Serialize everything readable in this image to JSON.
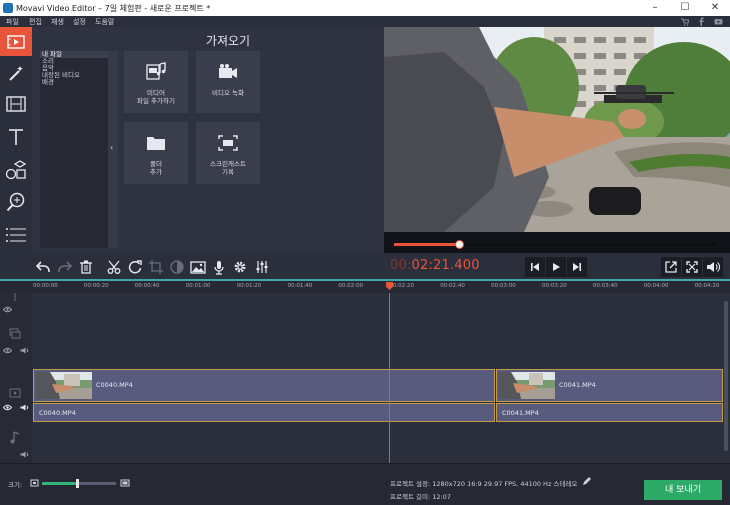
{
  "window": {
    "title": "Movavi Video Editor – 7일 체험판 - 새로운 프로젝트 *",
    "minimize": "–",
    "maximize": "☐",
    "close": "✕"
  },
  "menu": {
    "items": [
      "파일",
      "편집",
      "재생",
      "설정",
      "도움말"
    ]
  },
  "left_toolbar": {
    "items": [
      "import",
      "filters",
      "transitions",
      "titles",
      "stickers",
      "zoom",
      "more"
    ],
    "active": "import"
  },
  "import_panel": {
    "title": "가져오기",
    "categories": [
      "내 파일",
      "소리",
      "음악",
      "내장된 비디오",
      "배경"
    ],
    "selected_category": "내 파일",
    "collapse_glyph": "‹",
    "tiles": [
      {
        "label_1": "미디어",
        "label_2": "파일 추가하기",
        "icon": "media-files-icon"
      },
      {
        "label_1": "비디오 녹화",
        "label_2": "",
        "icon": "video-camera-icon"
      },
      {
        "label_1": "폴더",
        "label_2": "추가",
        "icon": "folder-icon"
      },
      {
        "label_1": "스크린캐스트",
        "label_2": "기록",
        "icon": "screencast-icon"
      }
    ]
  },
  "player": {
    "timecode_dim": "00:",
    "timecode_main": "02:21.400",
    "progress": 0.2
  },
  "ruler": {
    "ticks": [
      "00:00:00",
      "00:00:20",
      "00:00:40",
      "00:01:00",
      "00:01:20",
      "00:01:40",
      "00:02:00",
      "00:02:20",
      "00:02:40",
      "00:03:00",
      "00:03:20",
      "00:03:40",
      "00:04:00",
      "00:04:20"
    ]
  },
  "timeline": {
    "clips": [
      {
        "video_label": "C0040.MP4",
        "audio_label": "C0040.MP4"
      },
      {
        "video_label": "C0041.MP4",
        "audio_label": "C0041.MP4"
      }
    ]
  },
  "status": {
    "size_label": "크기:",
    "zoom_level": 0.47,
    "project_settings": "프로젝트 설정:  1280x720 16:9 29.97 FPS, 44100 Hz 스테레오",
    "project_length": "프로젝트 길이:  12:07",
    "export_label": "내 보내기"
  },
  "colors": {
    "accent": "#e8553b",
    "export": "#2eaa68",
    "clip": "#585b7e",
    "clip_border": "#c29b49",
    "timeline_line": "#3ea7a8"
  }
}
